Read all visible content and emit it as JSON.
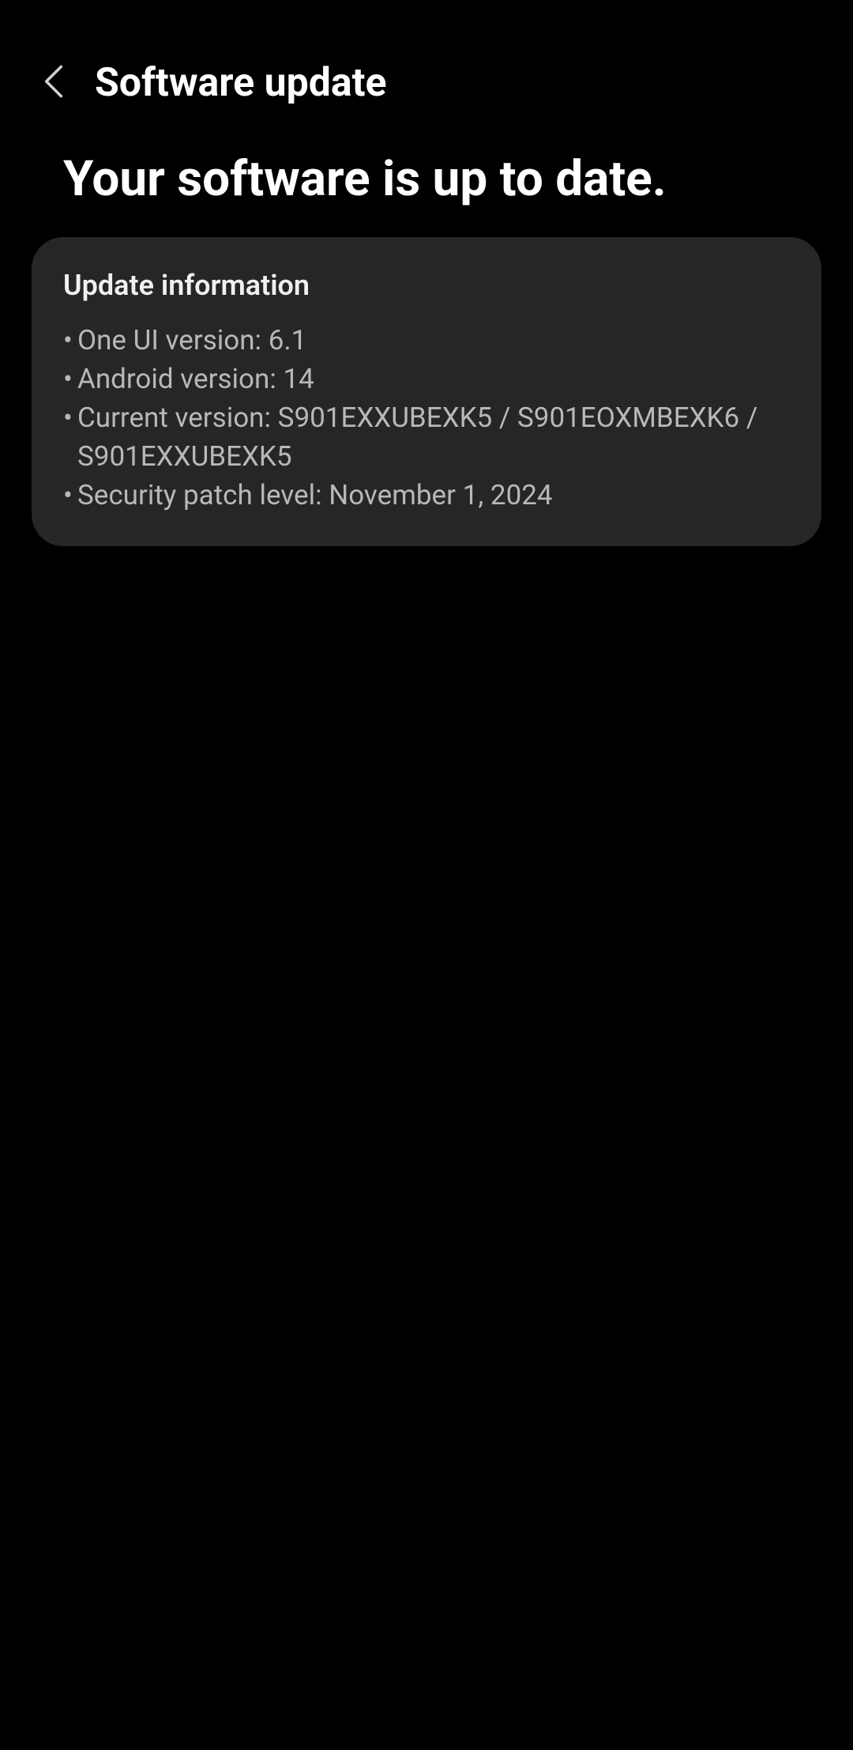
{
  "header": {
    "title": "Software update"
  },
  "main": {
    "status_heading": "Your software is up to date.",
    "card": {
      "title": "Update information",
      "items": [
        "One UI version: 6.1",
        "Android version: 14",
        "Current version: S901EXXUBEXK5 / S901EOXMBEXK6 / S901EXXUBEXK5",
        "Security patch level: November 1, 2024"
      ]
    }
  }
}
